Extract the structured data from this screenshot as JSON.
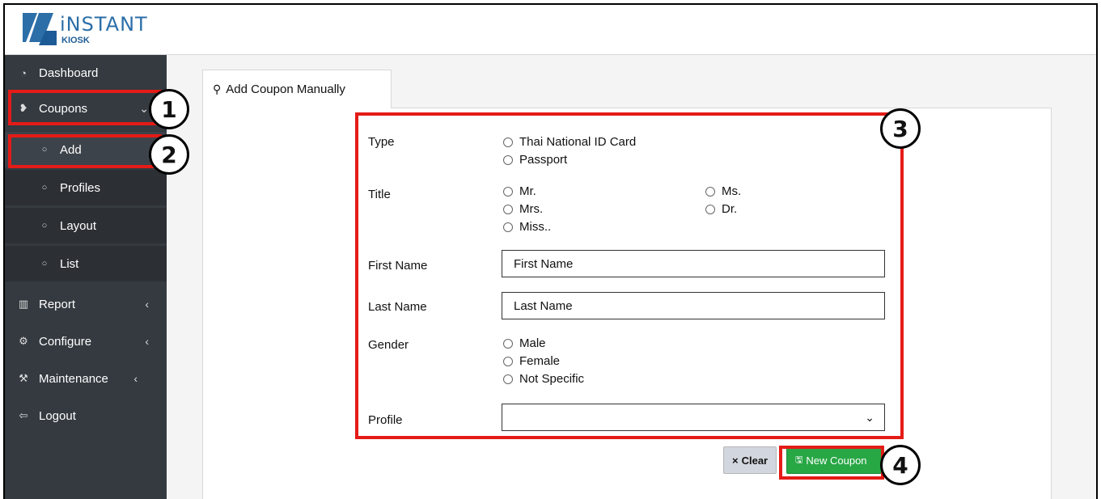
{
  "brand": {
    "name": "iNSTANT",
    "sub": "KIOSK",
    "color": "#2c6ea8"
  },
  "sidebar": {
    "items": [
      {
        "label": "Dashboard",
        "icon": "gauge-icon",
        "glyph": "◔"
      },
      {
        "label": "Coupons",
        "icon": "tags-icon",
        "glyph": "❥",
        "chevron": "⌄"
      },
      {
        "label": "Add",
        "icon": "circle-icon",
        "glyph": "○"
      },
      {
        "label": "Profiles",
        "icon": "circle-icon",
        "glyph": "○"
      },
      {
        "label": "Layout",
        "icon": "circle-icon",
        "glyph": "○"
      },
      {
        "label": "List",
        "icon": "circle-icon",
        "glyph": "○"
      },
      {
        "label": "Report",
        "icon": "bar-chart-icon",
        "glyph": "▥",
        "chevron": "‹"
      },
      {
        "label": "Configure",
        "icon": "gear-icon",
        "glyph": "⚙",
        "chevron": "‹"
      },
      {
        "label": "Maintenance",
        "icon": "wrench-icon",
        "glyph": "⚒",
        "chevron": "‹"
      },
      {
        "label": "Logout",
        "icon": "logout-icon",
        "glyph": "⇦"
      }
    ]
  },
  "tab": {
    "label": "Add Coupon Manually",
    "icon": "search-icon",
    "glyph": "⚲"
  },
  "form": {
    "type": {
      "label": "Type",
      "options": [
        "Thai National ID Card",
        "Passport"
      ]
    },
    "title": {
      "label": "Title",
      "options": [
        "Mr.",
        "Ms.",
        "Mrs.",
        "Dr.",
        "Miss.."
      ]
    },
    "first_name": {
      "label": "First Name",
      "placeholder": "First Name"
    },
    "last_name": {
      "label": "Last Name",
      "placeholder": "Last Name"
    },
    "gender": {
      "label": "Gender",
      "options": [
        "Male",
        "Female",
        "Not Specific"
      ]
    },
    "profile": {
      "label": "Profile",
      "value": "",
      "chevron": "⌄"
    }
  },
  "buttons": {
    "clear": {
      "label": "Clear",
      "glyph": "×"
    },
    "new_coupon": {
      "label": "New Coupon",
      "glyph": "🖫"
    }
  },
  "callouts": [
    "1",
    "2",
    "3",
    "4"
  ],
  "colors": {
    "sidebar": "#343a40",
    "highlight": "#e41b17",
    "primary": "#28a745"
  }
}
